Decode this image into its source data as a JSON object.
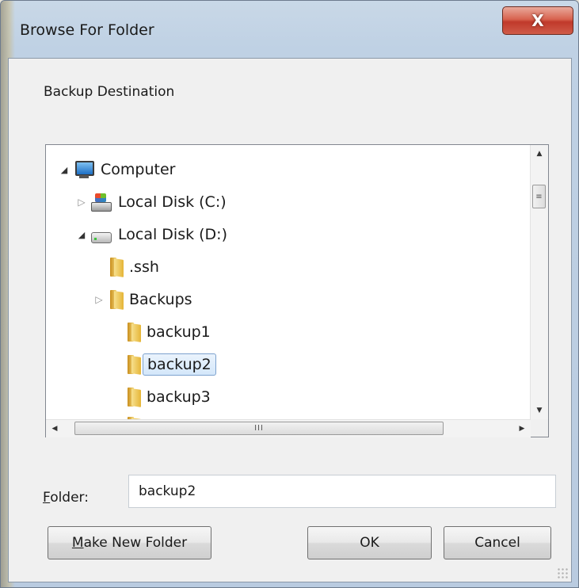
{
  "window": {
    "title": "Browse For Folder",
    "close_label": "X",
    "description": "Backup Destination"
  },
  "tree": {
    "items": [
      {
        "label": "Computer",
        "icon": "computer-icon",
        "expander": "expanded"
      },
      {
        "label": "Local Disk (C:)",
        "icon": "windows-drive-icon",
        "expander": "collapsed"
      },
      {
        "label": "Local Disk (D:)",
        "icon": "drive-icon",
        "expander": "expanded"
      },
      {
        "label": ".ssh",
        "icon": "folder-icon",
        "expander": "none"
      },
      {
        "label": "Backups",
        "icon": "folder-icon",
        "expander": "collapsed"
      },
      {
        "label": "backup1",
        "icon": "folder-icon",
        "expander": "none"
      },
      {
        "label": "backup2",
        "icon": "folder-icon",
        "expander": "none",
        "selected": true
      },
      {
        "label": "backup3",
        "icon": "folder-icon",
        "expander": "none"
      }
    ],
    "hscroll_grip": "III"
  },
  "folder_field": {
    "label_underlined": "F",
    "label_rest": "older:",
    "value": "backup2"
  },
  "buttons": {
    "make_new_underlined": "M",
    "make_new_rest": "ake New Folder",
    "ok": "OK",
    "cancel": "Cancel"
  },
  "colors": {
    "close_button": "#c0392b",
    "selection": "#d4e7fa"
  }
}
